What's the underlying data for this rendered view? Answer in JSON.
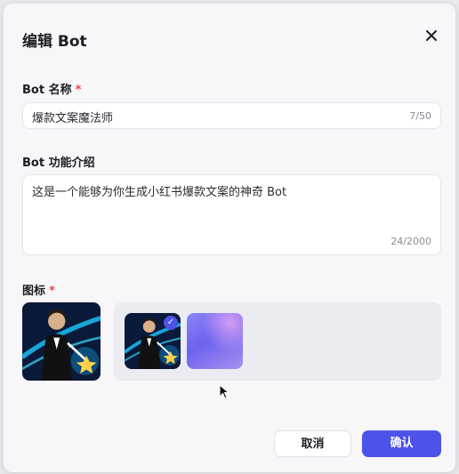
{
  "dialog": {
    "title": "编辑 Bot",
    "close_icon": "close-icon"
  },
  "name_field": {
    "label": "Bot 名称",
    "required_mark": "*",
    "value": "爆款文案魔法师",
    "counter": "7/50"
  },
  "desc_field": {
    "label": "Bot 功能介绍",
    "value": "这是一个能够为你生成小红书爆款文案的神奇 Bot",
    "counter": "24/2000"
  },
  "icon_field": {
    "label": "图标",
    "required_mark": "*",
    "selected_check": "✓",
    "selected_index": 0
  },
  "footer": {
    "cancel_label": "取消",
    "confirm_label": "确认"
  },
  "colors": {
    "accent": "#4d53e8",
    "required": "#e5484d"
  }
}
